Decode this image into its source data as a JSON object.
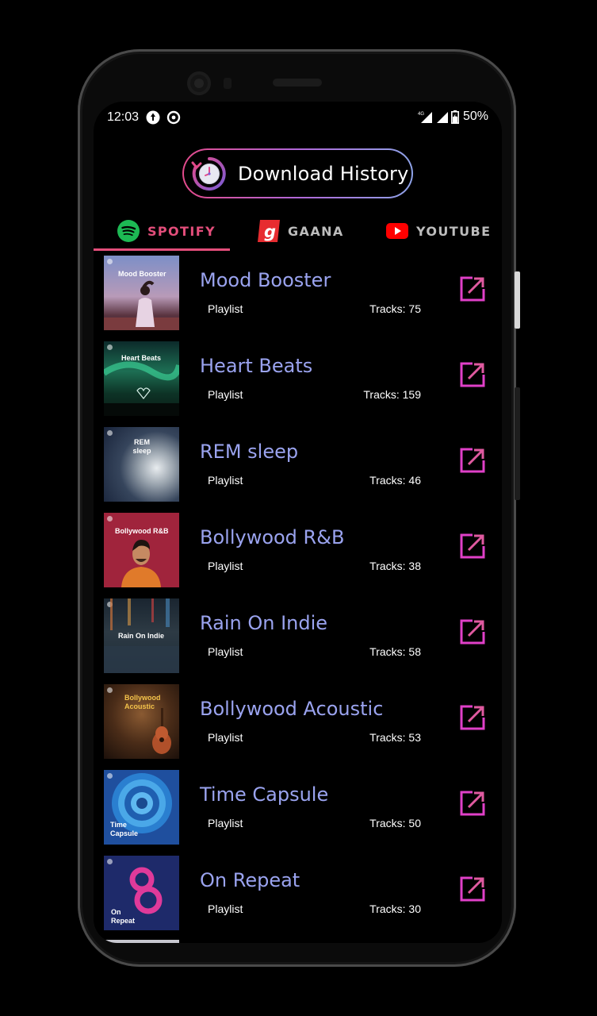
{
  "status_bar": {
    "time": "12:03",
    "network": "4G",
    "battery": "50%"
  },
  "header": {
    "title": "Download History"
  },
  "tabs": [
    {
      "label": "SPOTIFY",
      "icon": "spotify-icon",
      "active": true
    },
    {
      "label": "GAANA",
      "icon": "gaana-icon",
      "active": false
    },
    {
      "label": "YOUTUBE",
      "icon": "youtube-icon",
      "active": false
    }
  ],
  "playlists": [
    {
      "cover_text": "Mood Booster",
      "title": "Mood Booster",
      "type": "Playlist",
      "tracks": "Tracks: 75"
    },
    {
      "cover_text": "Heart Beats",
      "title": "Heart Beats",
      "type": "Playlist",
      "tracks": "Tracks: 159"
    },
    {
      "cover_text": "REM sleep",
      "title": "REM sleep",
      "type": "Playlist",
      "tracks": "Tracks: 46"
    },
    {
      "cover_text": "Bollywood R&B",
      "title": "Bollywood R&B",
      "type": "Playlist",
      "tracks": "Tracks: 38"
    },
    {
      "cover_text": "Rain On Indie",
      "title": "Rain On Indie",
      "type": "Playlist",
      "tracks": "Tracks: 58"
    },
    {
      "cover_text": "Bollywood Acoustic",
      "title": "Bollywood Acoustic",
      "type": "Playlist",
      "tracks": "Tracks: 53"
    },
    {
      "cover_text": "Time Capsule",
      "title": "Time Capsule",
      "type": "Playlist",
      "tracks": "Tracks: 50"
    },
    {
      "cover_text": "On Repeat",
      "title": "On Repeat",
      "type": "Playlist",
      "tracks": "Tracks: 30"
    }
  ],
  "colors": {
    "accent": "#e44e7b",
    "title_text": "#9aa3ef",
    "open_icon": "#e040c8",
    "background": "#000000"
  }
}
